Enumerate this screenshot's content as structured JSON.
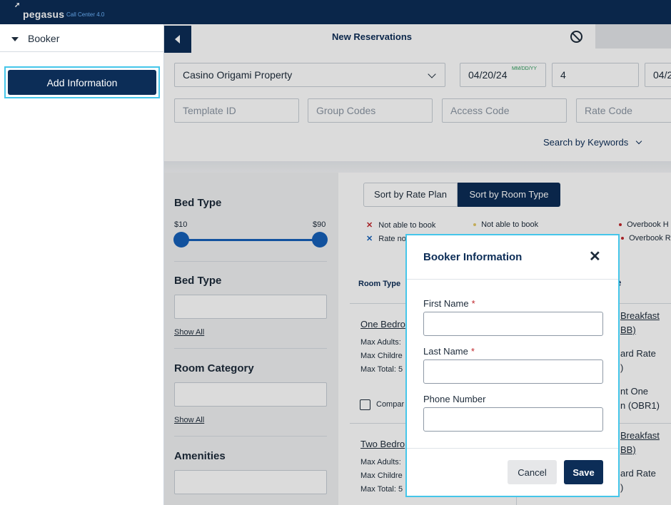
{
  "header": {
    "logo": "pegasus",
    "product": "Call Center 4.0"
  },
  "sidebar": {
    "section_label": "Booker",
    "add_button": "Add Information"
  },
  "main": {
    "title": "New Reservations",
    "property": "Casino Origami Property",
    "arrival_date": "04/20/24",
    "date_format": "MM/DD/YY",
    "nights": "4",
    "departure_date_partial": "04/2",
    "template_placeholder": "Template ID",
    "group_placeholder": "Group Codes",
    "access_placeholder": "Access Code",
    "rate_placeholder": "Rate Code",
    "search_keywords": "Search by Keywords"
  },
  "filters": {
    "bed_type_heading": "Bed Type",
    "price_min": "$10",
    "price_max": "$90",
    "bed_type_heading2": "Bed Type",
    "show_all": "Show All",
    "room_category_heading": "Room Category",
    "amenities_heading": "Amenities"
  },
  "results": {
    "sort_rate": "Sort by Rate Plan",
    "sort_room": "Sort by Room Type",
    "legend": {
      "not_able_red": "Not able to book",
      "not_able_yellow": "Not able to book",
      "overbook_h": "Overbook H",
      "rate_partial": "Rate no",
      "overbook_r": "Overbook R"
    },
    "col_room_type": "Room Type",
    "col_right_partial": "e",
    "rooms": [
      {
        "name": "One Bedro",
        "max_adults": "Max Adults:",
        "max_children": "Max Childre",
        "max_total": "Max Total: 5",
        "compare": "Compar",
        "rate1_line1": "Breakfast",
        "rate1_line2": "BB)",
        "rate2_line1": "ard Rate",
        "rate2_line2": ")",
        "rate3_line1": "nt One",
        "rate3_line2": "n (OBR1)"
      },
      {
        "name": "Two Bedro",
        "max_adults": "Max Adults:",
        "max_children": "Max Childre",
        "max_total": "Max Total: 5",
        "rate1_line1": "Breakfast",
        "rate1_line2": "BB)",
        "rate2_line1": "ard Rate",
        "rate2_line2": ")"
      }
    ]
  },
  "modal": {
    "title": "Booker Information",
    "first_name_label": "First Name",
    "last_name_label": "Last Name",
    "phone_label": "Phone Number",
    "required_marker": "*",
    "cancel": "Cancel",
    "save": "Save"
  }
}
